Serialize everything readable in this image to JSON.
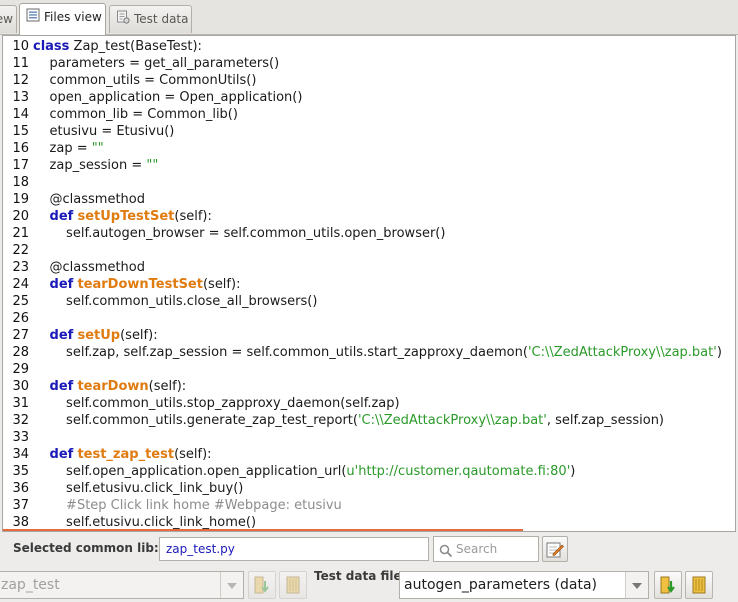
{
  "tabs": {
    "partial_label": "ew",
    "files_label": "Files view",
    "test_label": "Test data"
  },
  "editor": {
    "lines": [
      {
        "n": "10",
        "segs": [
          {
            "t": "class",
            "c": "kw"
          },
          {
            "t": " Zap_test(BaseTest):"
          }
        ]
      },
      {
        "n": "11",
        "segs": [
          {
            "t": "    parameters = get_all_parameters()"
          }
        ]
      },
      {
        "n": "12",
        "segs": [
          {
            "t": "    common_utils = CommonUtils()"
          }
        ]
      },
      {
        "n": "13",
        "segs": [
          {
            "t": "    open_application = Open_application()"
          }
        ]
      },
      {
        "n": "14",
        "segs": [
          {
            "t": "    common_lib = Common_lib()"
          }
        ]
      },
      {
        "n": "15",
        "segs": [
          {
            "t": "    etusivu = Etusivu()"
          }
        ]
      },
      {
        "n": "16",
        "segs": [
          {
            "t": "    zap = "
          },
          {
            "t": "\"\"",
            "c": "str"
          }
        ]
      },
      {
        "n": "17",
        "segs": [
          {
            "t": "    zap_session = "
          },
          {
            "t": "\"\"",
            "c": "str"
          }
        ]
      },
      {
        "n": "18",
        "segs": []
      },
      {
        "n": "19",
        "segs": [
          {
            "t": "    @classmethod"
          }
        ]
      },
      {
        "n": "20",
        "segs": [
          {
            "t": "    "
          },
          {
            "t": "def",
            "c": "kw"
          },
          {
            "t": " "
          },
          {
            "t": "setUpTestSet",
            "c": "fn"
          },
          {
            "t": "(self):"
          }
        ]
      },
      {
        "n": "21",
        "segs": [
          {
            "t": "        self.autogen_browser = self.common_utils.open_browser()"
          }
        ]
      },
      {
        "n": "22",
        "segs": []
      },
      {
        "n": "23",
        "segs": [
          {
            "t": "    @classmethod"
          }
        ]
      },
      {
        "n": "24",
        "segs": [
          {
            "t": "    "
          },
          {
            "t": "def",
            "c": "kw"
          },
          {
            "t": " "
          },
          {
            "t": "tearDownTestSet",
            "c": "fn"
          },
          {
            "t": "(self):"
          }
        ]
      },
      {
        "n": "25",
        "segs": [
          {
            "t": "        self.common_utils.close_all_browsers()"
          }
        ]
      },
      {
        "n": "26",
        "segs": []
      },
      {
        "n": "27",
        "segs": [
          {
            "t": "    "
          },
          {
            "t": "def",
            "c": "kw"
          },
          {
            "t": " "
          },
          {
            "t": "setUp",
            "c": "fn"
          },
          {
            "t": "(self):"
          }
        ]
      },
      {
        "n": "28",
        "segs": [
          {
            "t": "        self.zap, self.zap_session = self.common_utils.start_zapproxy_daemon("
          },
          {
            "t": "'C:\\\\ZedAttackProxy\\\\zap.bat'",
            "c": "str"
          },
          {
            "t": ")"
          }
        ]
      },
      {
        "n": "29",
        "segs": []
      },
      {
        "n": "30",
        "segs": [
          {
            "t": "    "
          },
          {
            "t": "def",
            "c": "kw"
          },
          {
            "t": " "
          },
          {
            "t": "tearDown",
            "c": "fn"
          },
          {
            "t": "(self):"
          }
        ]
      },
      {
        "n": "31",
        "segs": [
          {
            "t": "        self.common_utils.stop_zapproxy_daemon(self.zap)"
          }
        ]
      },
      {
        "n": "32",
        "segs": [
          {
            "t": "        self.common_utils.generate_zap_test_report("
          },
          {
            "t": "'C:\\\\ZedAttackProxy\\\\zap.bat'",
            "c": "str"
          },
          {
            "t": ", self.zap_session)"
          }
        ]
      },
      {
        "n": "33",
        "segs": []
      },
      {
        "n": "34",
        "segs": [
          {
            "t": "    "
          },
          {
            "t": "def",
            "c": "kw"
          },
          {
            "t": " "
          },
          {
            "t": "test_zap_test",
            "c": "fn"
          },
          {
            "t": "(self):"
          }
        ]
      },
      {
        "n": "35",
        "segs": [
          {
            "t": "        self.open_application.open_application_url("
          },
          {
            "t": "u'http://customer.qautomate.fi:80'",
            "c": "str"
          },
          {
            "t": ")"
          }
        ]
      },
      {
        "n": "36",
        "segs": [
          {
            "t": "        self.etusivu.click_link_buy()"
          }
        ]
      },
      {
        "n": "37",
        "segs": [
          {
            "t": "        #Step Click link home #Webpage: etusivu",
            "c": "cm"
          }
        ]
      },
      {
        "n": "38",
        "segs": [
          {
            "t": "        self.etusivu.click_link_home()"
          }
        ]
      }
    ]
  },
  "lib": {
    "label": "Selected common lib:",
    "value": "zap_test.py",
    "search_placeholder": "Search"
  },
  "bottom": {
    "left_combo_value": "zap_test",
    "test_data_label": "Test data file:",
    "right_combo_value": "autogen_parameters (data)"
  },
  "colors": {
    "keyword": "#1a1ab8",
    "function_name": "#e07b10",
    "string": "#2a9a2a",
    "comment": "#8c8c8c",
    "accent_line": "#e46c3b"
  },
  "icons": {
    "files_tab": "file-list-icon",
    "test_tab": "test-data-icon",
    "search": "search-icon",
    "edit": "edit-pencil-icon",
    "add": "add-arrow-icon",
    "open": "open-book-icon"
  }
}
